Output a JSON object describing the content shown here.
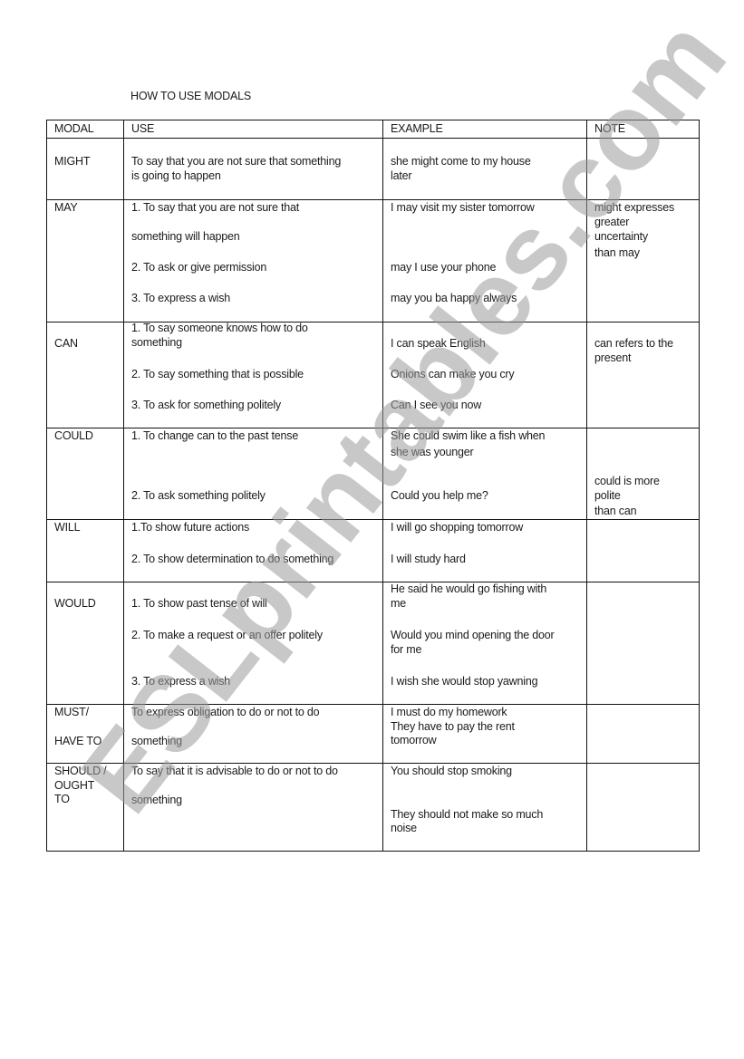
{
  "document": {
    "title": "HOW TO USE MODALS",
    "watermark": "ESLprintables.com",
    "headers": {
      "modal": "MODAL",
      "use": "USE",
      "example": "EXAMPLE",
      "note": "NOTE"
    },
    "rows": [
      {
        "modal": [
          "MIGHT"
        ],
        "use": [
          "To say that you are not sure that something",
          "is going to happen"
        ],
        "example": [
          "she might come to my house",
          "later"
        ],
        "note": []
      },
      {
        "modal": [
          "MAY"
        ],
        "use": [
          "1. To say that you are not sure that",
          "something will happen",
          "2. To ask or give permission",
          "3. To express a wish"
        ],
        "example": [
          "I may visit my sister tomorrow",
          "may I use your phone",
          "may you ba happy always"
        ],
        "note": [
          "might expresses",
          "greater",
          "uncertainty",
          "than may"
        ]
      },
      {
        "modal": [
          "CAN"
        ],
        "use": [
          "1. To say someone knows how to do",
          "something",
          "2. To say something that is possible",
          "3. To ask for something politely"
        ],
        "example": [
          "I can speak English",
          "Onions can make you cry",
          "Can I see you now"
        ],
        "note": [
          "can refers to the",
          "present"
        ]
      },
      {
        "modal": [
          "COULD"
        ],
        "use": [
          "1. To change can to the past tense",
          "2. To ask something politely"
        ],
        "example": [
          "She could swim like a fish when",
          "she was younger",
          "Could you help me?"
        ],
        "note": [
          "could is more",
          "polite",
          "than can"
        ]
      },
      {
        "modal": [
          "WILL"
        ],
        "use": [
          "1.To show future actions",
          "2. To show determination to do something"
        ],
        "example": [
          "I will go shopping tomorrow",
          "I will study hard"
        ],
        "note": []
      },
      {
        "modal": [
          "WOULD"
        ],
        "use": [
          "1. To show past tense of will",
          "2. To make a request or an offer politely",
          "3. To express a wish"
        ],
        "example": [
          "He said he would go fishing with",
          "me",
          "Would you mind opening the door",
          "for me",
          "I wish she would stop yawning"
        ],
        "note": []
      },
      {
        "modal": [
          "MUST/",
          "HAVE TO"
        ],
        "use": [
          "To express obligation to do or not to do",
          "something"
        ],
        "example": [
          "I must do my homework",
          "They have to pay the rent",
          "tomorrow"
        ],
        "note": []
      },
      {
        "modal": [
          "SHOULD /",
          "OUGHT",
          "TO"
        ],
        "use": [
          "To say that it is advisable to do or not to do",
          "something"
        ],
        "example": [
          "You should stop smoking",
          "They should not make so much",
          "noise"
        ],
        "note": []
      }
    ]
  }
}
